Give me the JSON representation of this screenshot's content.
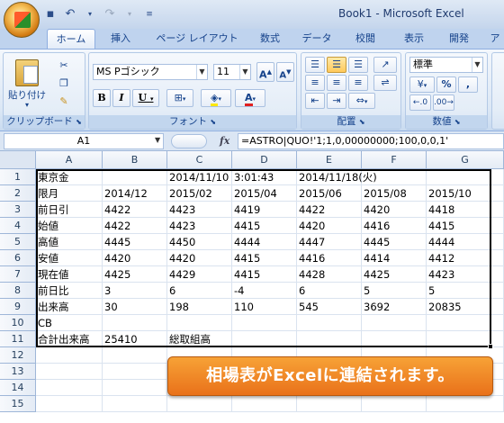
{
  "titlebar": {
    "title": "Book1 - Microsoft Excel"
  },
  "tabs": [
    "ホーム",
    "挿入",
    "ページ レイアウト",
    "数式",
    "データ",
    "校閲",
    "表示",
    "開発",
    "ア"
  ],
  "ribbon": {
    "clipboard": {
      "paste_label": "貼り付け",
      "group_label": "クリップボード"
    },
    "font": {
      "font_name": "MS Pゴシック",
      "font_size": "11",
      "group_label": "フォント"
    },
    "alignment": {
      "group_label": "配置"
    },
    "number": {
      "format": "標準",
      "percent": "%",
      "comma": ",",
      "group_label": "数値"
    }
  },
  "formula_bar": {
    "name_box": "A1",
    "fx": "fx",
    "formula": "=ASTRO|QUO!'1;1,0,00000000;100,0,0,1'"
  },
  "sheet": {
    "columns": [
      "A",
      "B",
      "C",
      "D",
      "E",
      "F",
      "G"
    ],
    "rows": [
      "1",
      "2",
      "3",
      "4",
      "5",
      "6",
      "7",
      "8",
      "9",
      "10",
      "11",
      "12",
      "13",
      "14",
      "15"
    ],
    "cells": {
      "r1": [
        "東京金",
        "",
        "2014/11/10",
        "3:01:43",
        "2014/11/18(火)",
        "",
        ""
      ],
      "r2": [
        "限月",
        "2014/12",
        "2015/02",
        "2015/04",
        "2015/06",
        "2015/08",
        "2015/10"
      ],
      "r3": [
        "前日引",
        "4422",
        "4423",
        "4419",
        "4422",
        "4420",
        "4418"
      ],
      "r4": [
        "始値",
        "4422",
        "4423",
        "4415",
        "4420",
        "4416",
        "4415"
      ],
      "r5": [
        "高値",
        "4445",
        "4450",
        "4444",
        "4447",
        "4445",
        "4444"
      ],
      "r6": [
        "安値",
        "4420",
        "4420",
        "4415",
        "4416",
        "4414",
        "4412"
      ],
      "r7": [
        "現在値",
        "4425",
        "4429",
        "4415",
        "4428",
        "4425",
        "4423"
      ],
      "r8": [
        "前日比",
        "3",
        "6",
        "-4",
        "6",
        "5",
        "5"
      ],
      "r9": [
        "出来高",
        "30",
        "198",
        "110",
        "545",
        "3692",
        "20835"
      ],
      "r10": [
        "CB",
        "",
        "",
        "",
        "",
        "",
        ""
      ],
      "r11": [
        "合計出来高",
        "25410",
        "総取組高",
        "",
        "",
        "",
        ""
      ]
    }
  },
  "banner": {
    "text": "相場表がExcelに連結されます。"
  },
  "colors": {
    "accent": "#15428b",
    "banner": "#ee7c22"
  }
}
